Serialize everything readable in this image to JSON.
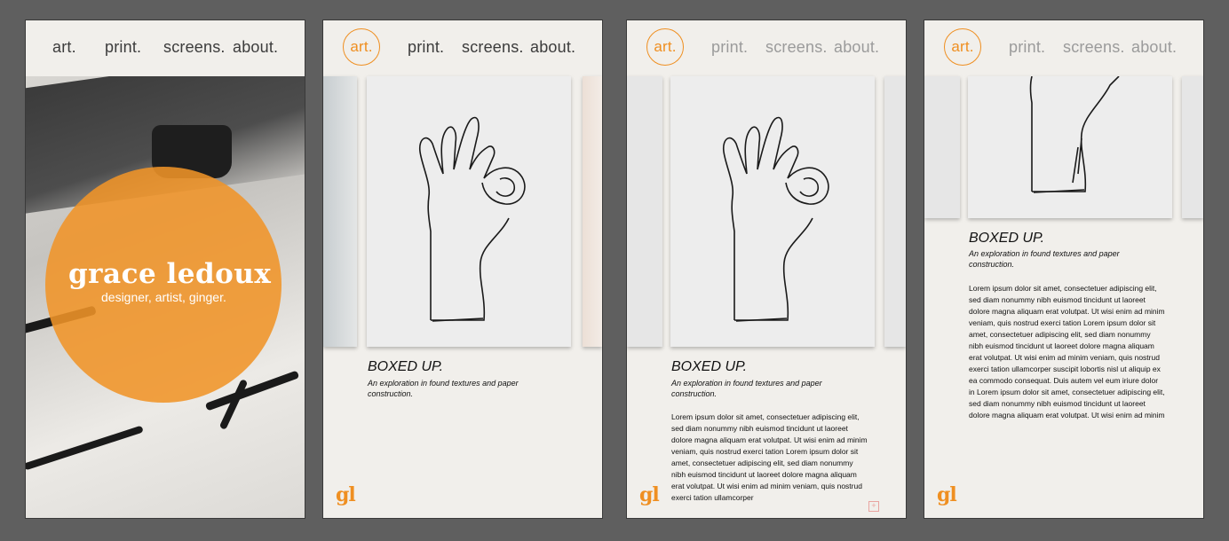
{
  "nav": {
    "art": "art.",
    "print": "print.",
    "screens": "screens.",
    "about": "about."
  },
  "hero": {
    "name": "grace ledoux",
    "tagline": "designer, artist, ginger."
  },
  "project": {
    "title": "BOXED UP.",
    "subtitle": "An exploration in found textures and paper construction.",
    "body_short": "Lorem ipsum dolor sit amet, consectetuer adipiscing elit, sed diam nonummy nibh euismod tincidunt ut laoreet dolore magna aliquam erat volutpat. Ut wisi enim ad minim veniam, quis nostrud exerci tation Lorem ipsum dolor sit amet, consectetuer adipiscing elit, sed diam nonummy nibh euismod tincidunt ut laoreet dolore magna aliquam erat volutpat. Ut wisi enim ad minim veniam, quis nostrud exerci tation ullamcorper",
    "body_long": "Lorem ipsum dolor sit amet, consectetuer adipiscing elit, sed diam nonummy nibh euismod tincidunt ut laoreet dolore magna aliquam erat volutpat. Ut wisi enim ad minim veniam, quis nostrud exerci tation Lorem ipsum dolor sit amet, consectetuer adipiscing elit, sed diam nonummy nibh euismod tincidunt ut laoreet dolore magna aliquam erat volutpat. Ut wisi enim ad minim veniam, quis nostrud exerci tation ullamcorper suscipit lobortis nisl ut aliquip ex ea commodo consequat. Duis autem vel eum iriure dolor in Lorem ipsum dolor sit amet, consectetuer adipiscing elit, sed diam nonummy nibh euismod tincidunt ut laoreet dolore magna aliquam erat volutpat. Ut wisi enim ad minim"
  },
  "logo": "gl",
  "icons": {
    "expand": "plus-square-icon",
    "artwork": "wire-hand-ok-icon"
  },
  "colors": {
    "accent": "#ef8f21",
    "background": "#5f5f5f",
    "page": "#f1efeb"
  }
}
